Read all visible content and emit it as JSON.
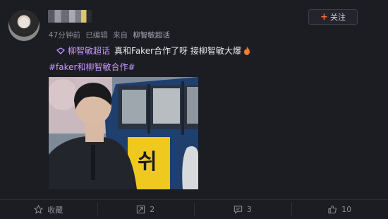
{
  "post": {
    "time": "47分钟前",
    "edited": "已编辑",
    "via_label": "来自",
    "source": "柳智敏超话",
    "follow_label": "关注",
    "topic": "柳智敏超话",
    "text": "真和Faker合作了呀 接柳智敏大爆",
    "hashtag": "#faker和柳智敏合作#",
    "bus_sign": "쉬"
  },
  "actions": {
    "collect": "收藏",
    "repost": "2",
    "comment": "3",
    "like": "10"
  },
  "colors": {
    "background": "#1c1c23",
    "topic": "#c79bff",
    "accent": "#ff6a2a"
  },
  "icons": [
    "topic-icon",
    "fire-icon",
    "star-icon",
    "repost-icon",
    "comment-icon",
    "thumbs-up-icon"
  ]
}
